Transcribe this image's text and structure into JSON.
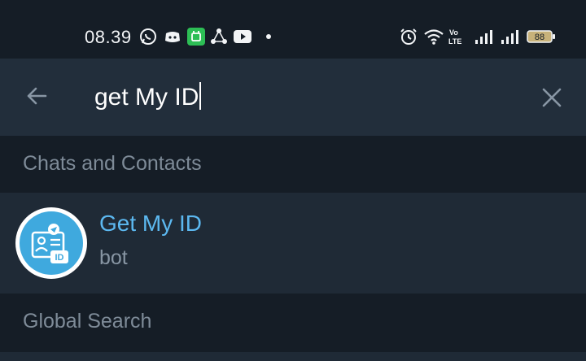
{
  "status_bar": {
    "time": "08.39",
    "battery_level": "88",
    "icons_left": [
      "whatsapp-icon",
      "discord-icon",
      "wechat-icon",
      "share-icon",
      "youtube-icon",
      "dot-icon"
    ],
    "icons_right": [
      "alarm-icon",
      "wifi-icon",
      "volte-icon",
      "signal-icon",
      "signal-icon",
      "battery-icon"
    ]
  },
  "search": {
    "query": "get My ID",
    "back_icon": "arrow-left-icon",
    "clear_icon": "close-icon"
  },
  "sections": {
    "chats_header": "Chats and Contacts",
    "global_header": "Global Search"
  },
  "results": [
    {
      "name": "Get My ID",
      "subtitle": "bot",
      "avatar_badge": "ID"
    }
  ],
  "colors": {
    "background": "#151d26",
    "surface": "#222e3b",
    "row": "#1f2a36",
    "accent": "#5cb8f0",
    "muted": "#7e8b98",
    "avatar": "#3fa9de"
  }
}
